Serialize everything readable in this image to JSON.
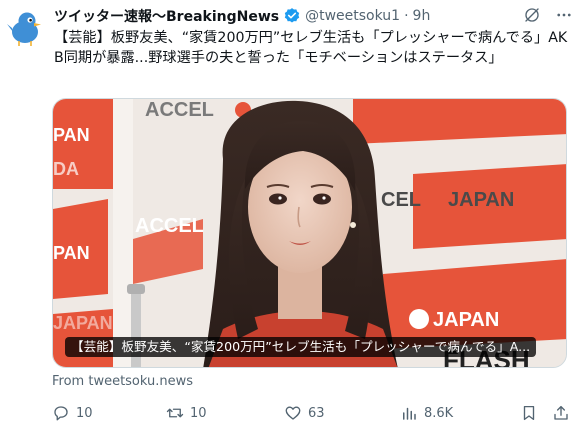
{
  "tweet": {
    "display_name": "ツイッター速報〜BreakingNews",
    "handle": "@tweetsoku1",
    "separator": "·",
    "time": "9h",
    "text": "【芸能】板野友美、“家賃200万円”セレブ生活も「プレッシャーで病んでる」AKB同期が暴露...野球選手の夫と誓った「モチベーションはステータス」",
    "media": {
      "caption": "【芸能】板野友美、“家賃200万円”セレブ生活も「プレッシャーで病んでる」A...",
      "backdrop_text": {
        "accel_1": "ACCEL",
        "accel_2": "ACCEL",
        "accel_3": "CEL",
        "japan_1": "JAPAN",
        "japan_2": "JAPAN",
        "japan_3": "JAPAN",
        "pan_1": "PAN",
        "pan_2": "PAN",
        "da": "DA",
        "flash": "FLASH"
      }
    },
    "source": "From tweetsoku.news",
    "actions": {
      "replies": "10",
      "retweets": "10",
      "likes": "63",
      "views": "8.6K"
    }
  },
  "colors": {
    "text": "#0f1419",
    "muted": "#536471",
    "verified": "#1d9bf0",
    "banner_red": "#e6543a",
    "avatar_blue": "#3f8fd6"
  },
  "icons": {
    "avatar": "bird-avatar-icon",
    "verified": "verified-badge-icon",
    "grok": "grok-icon",
    "more": "more-icon",
    "reply": "reply-icon",
    "retweet": "retweet-icon",
    "like": "like-icon",
    "views": "views-icon",
    "bookmark": "bookmark-icon",
    "share": "share-icon"
  }
}
